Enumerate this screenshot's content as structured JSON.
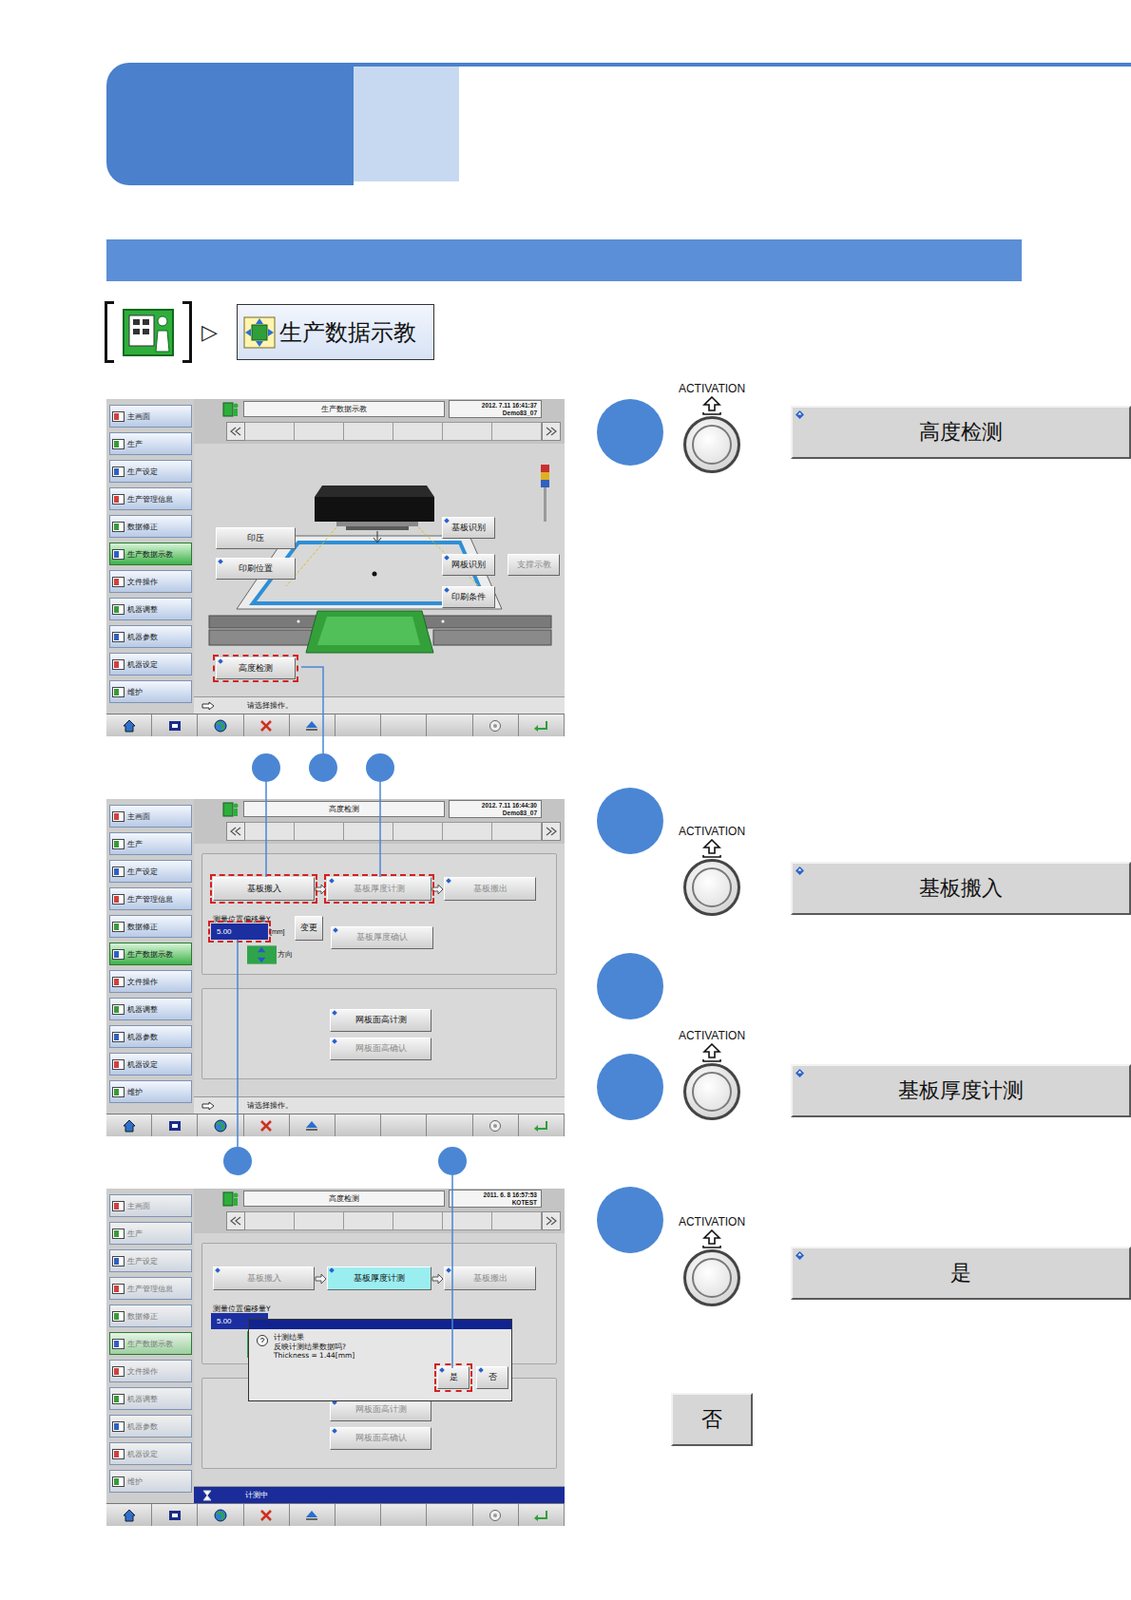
{
  "breadcrumb": {
    "separator": "▷",
    "label": "生产数据示教"
  },
  "screens": [
    {
      "kind": "diagram",
      "title": "生产数据示教",
      "date": "2012. 7.11 16:41:37",
      "machine": "Demo83_07",
      "sidebar_disabled": false,
      "sidebar": [
        {
          "label": "主画面",
          "selected": false
        },
        {
          "label": "生产",
          "selected": false
        },
        {
          "label": "生产设定",
          "selected": false
        },
        {
          "label": "生产管理信息",
          "selected": false
        },
        {
          "label": "数据修正",
          "selected": false
        },
        {
          "label": "生产数据示教",
          "selected": true
        },
        {
          "label": "文件操作",
          "selected": false
        },
        {
          "label": "机器调整",
          "selected": false
        },
        {
          "label": "机器参数",
          "selected": false
        },
        {
          "label": "机器设定",
          "selected": false
        },
        {
          "label": "维护",
          "selected": false
        }
      ],
      "diagram_buttons": [
        {
          "label": "印压",
          "disabled": false,
          "marker": false,
          "highlight": false
        },
        {
          "label": "印刷位置",
          "disabled": false,
          "marker": true,
          "highlight": false
        },
        {
          "label": "基板识别",
          "disabled": false,
          "marker": true,
          "highlight": false
        },
        {
          "label": "网板识别",
          "disabled": false,
          "marker": true,
          "highlight": false
        },
        {
          "label": "支撑示教",
          "disabled": true,
          "marker": false,
          "highlight": false
        },
        {
          "label": "印刷条件",
          "disabled": false,
          "marker": true,
          "highlight": false
        },
        {
          "label": "高度检测",
          "disabled": false,
          "marker": true,
          "highlight": true
        }
      ],
      "status": "请选择操作。",
      "status_busy": false
    },
    {
      "kind": "height",
      "title": "高度检测",
      "date": "2012. 7.11 16:44:30",
      "machine": "Demo83_07",
      "sidebar_disabled": false,
      "sidebar": [
        {
          "label": "主画面",
          "selected": false
        },
        {
          "label": "生产",
          "selected": false
        },
        {
          "label": "生产设定",
          "selected": false
        },
        {
          "label": "生产管理信息",
          "selected": false
        },
        {
          "label": "数据修正",
          "selected": false
        },
        {
          "label": "生产数据示教",
          "selected": true
        },
        {
          "label": "文件操作",
          "selected": false
        },
        {
          "label": "机器调整",
          "selected": false
        },
        {
          "label": "机器参数",
          "selected": false
        },
        {
          "label": "机器设定",
          "selected": false
        },
        {
          "label": "维护",
          "selected": false
        }
      ],
      "steps_row": [
        {
          "label": "基板搬入",
          "disabled": false,
          "selected": false,
          "marker": false,
          "highlight": true
        },
        {
          "label": "基板厚度计测",
          "disabled": true,
          "selected": false,
          "marker": true,
          "highlight": true
        },
        {
          "label": "基板搬出",
          "disabled": true,
          "selected": false,
          "marker": true,
          "highlight": false
        }
      ],
      "offset_label": "测量位置偏移量Y",
      "offset_value": "5.00",
      "offset_highlight": true,
      "unit": "[mm]",
      "change_button": "变更",
      "confirm_button": {
        "label": "基板厚度确认",
        "disabled": true,
        "marker": true
      },
      "direction": "方向",
      "mask_buttons": [
        {
          "label": "网板面高计测",
          "disabled": false,
          "marker": true
        },
        {
          "label": "网板面高确认",
          "disabled": true,
          "marker": true
        }
      ],
      "status": "请选择操作。",
      "status_busy": false
    },
    {
      "kind": "height",
      "title": "高度检测",
      "date": "2011. 6. 8 16:57:53",
      "machine": "KOTEST",
      "sidebar_disabled": true,
      "sidebar": [
        {
          "label": "主画面",
          "selected": false
        },
        {
          "label": "生产",
          "selected": false
        },
        {
          "label": "生产设定",
          "selected": false
        },
        {
          "label": "生产管理信息",
          "selected": false
        },
        {
          "label": "数据修正",
          "selected": false
        },
        {
          "label": "生产数据示教",
          "selected": true
        },
        {
          "label": "文件操作",
          "selected": false
        },
        {
          "label": "机器调整",
          "selected": false
        },
        {
          "label": "机器参数",
          "selected": false
        },
        {
          "label": "机器设定",
          "selected": false
        },
        {
          "label": "维护",
          "selected": false
        }
      ],
      "steps_row": [
        {
          "label": "基板搬入",
          "disabled": true,
          "selected": false,
          "marker": true,
          "highlight": false
        },
        {
          "label": "基板厚度计测",
          "disabled": false,
          "selected": true,
          "marker": true,
          "highlight": false
        },
        {
          "label": "基板搬出",
          "disabled": true,
          "selected": false,
          "marker": true,
          "highlight": false
        }
      ],
      "offset_label": "测量位置偏移量Y",
      "offset_value": "5.00",
      "offset_highlight": false,
      "mask_buttons": [
        {
          "label": "网板面高计测",
          "disabled": true,
          "marker": true
        },
        {
          "label": "网板面高确认",
          "disabled": true,
          "marker": true
        }
      ],
      "dialog": {
        "lines": [
          "计测结果",
          "反映计测结果数据吗?",
          "Thickness = 1.44[mm]"
        ],
        "buttons": [
          {
            "label": "是",
            "highlight": true
          },
          {
            "label": "否",
            "highlight": false
          }
        ]
      },
      "status": "计测中",
      "status_busy": true
    }
  ],
  "step_groups": [
    [
      {
        "kind": "activation",
        "caption": "ACTIVATION",
        "button": "高度检测"
      }
    ],
    [
      {
        "kind": "activation",
        "caption": "ACTIVATION",
        "button": "基板搬入"
      },
      {
        "kind": "note"
      },
      {
        "kind": "activation",
        "caption": "ACTIVATION",
        "button": "基板厚度计测"
      }
    ],
    [
      {
        "kind": "activation",
        "caption": "ACTIVATION",
        "button": "是"
      },
      {
        "kind": "alternative",
        "button": "否"
      }
    ]
  ]
}
